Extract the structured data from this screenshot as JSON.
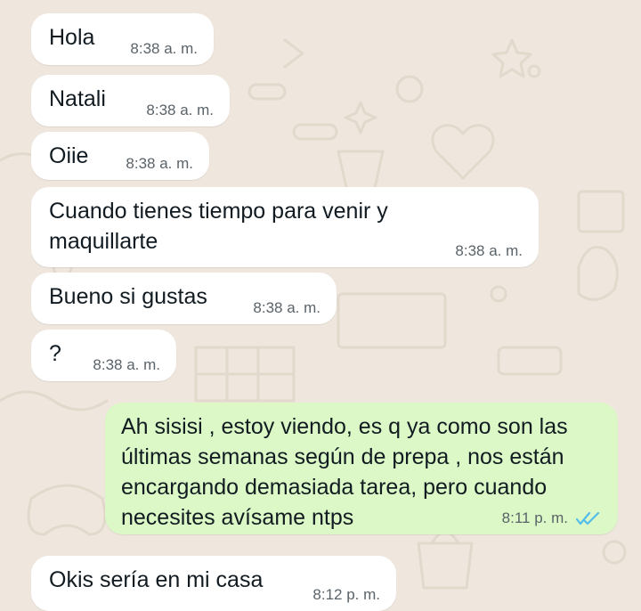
{
  "conversation": {
    "messages": [
      {
        "text": "Hola",
        "time": "8:38 a. m."
      },
      {
        "text": "Natali",
        "time": "8:38 a. m."
      },
      {
        "text": "Oiie",
        "time": "8:38 a. m."
      },
      {
        "text": "Cuando tienes tiempo para venir y maquillarte",
        "time": "8:38 a. m."
      },
      {
        "text": "Bueno si gustas",
        "time": "8:38 a. m."
      },
      {
        "text": "?",
        "time": "8:38 a. m."
      },
      {
        "text": "Ah sisisi , estoy viendo, es q ya como son las últimas semanas según de prepa , nos están encargando demasiada tarea, pero cuando necesites avísame ntps",
        "time": "8:11 p. m.",
        "status_icon": "double-check-read-icon",
        "status_color": "#53bdeb"
      },
      {
        "text": "Okis sería en mi casa",
        "time": "8:12 p. m."
      }
    ]
  },
  "colors": {
    "wallpaper": "#efe7dd",
    "incoming_bubble": "#ffffff",
    "outgoing_bubble": "#dbf8c6",
    "timestamp": "#5a6369",
    "read_ticks": "#53bdeb"
  }
}
